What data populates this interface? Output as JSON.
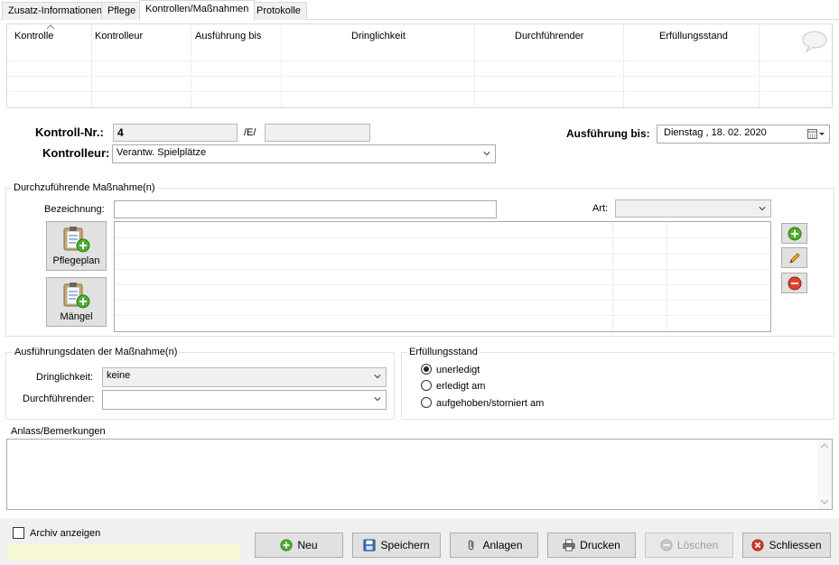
{
  "tabs": [
    {
      "label": "Zusatz-Informationen"
    },
    {
      "label": "Pflege"
    },
    {
      "label": "Kontrollen/Maßnahmen"
    },
    {
      "label": "Protokolle"
    }
  ],
  "grid": {
    "columns": [
      "Kontrolle",
      "Kontrolleur",
      "Ausführung bis",
      "Dringlichkeit",
      "Durchführender",
      "Erfüllungsstand"
    ]
  },
  "form": {
    "kontroll_nr_label": "Kontroll-Nr.:",
    "kontroll_nr_value": "4",
    "e_separator": "/E/",
    "e_value": "",
    "ausfuehrung_label": "Ausführung bis:",
    "ausfuehrung_day": "Dienstag",
    "ausfuehrung_date": ", 18. 02. 2020",
    "kontrolleur_label": "Kontrolleur:",
    "kontrolleur_value": "Verantw. Spielplätze"
  },
  "massnahme": {
    "group_title": "Durchzuführende Maßnahme(n)",
    "bezeichnung_label": "Bezeichnung:",
    "bezeichnung_value": "",
    "art_label": "Art:",
    "art_value": "",
    "pflegeplan_label": "Pflegeplan",
    "maengel_label": "Mängel"
  },
  "ausfuehrungsdaten": {
    "group_title": "Ausführungsdaten der Maßnahme(n)",
    "dringlichkeit_label": "Dringlichkeit:",
    "dringlichkeit_value": "keine",
    "durchfuehrender_label": "Durchführender:",
    "durchfuehrender_value": ""
  },
  "erfuellungsstand": {
    "group_title": "Erfüllungsstand",
    "options": [
      "unerledigt",
      "erledigt am",
      "aufgehoben/storniert am"
    ],
    "selected": "unerledigt"
  },
  "anlass": {
    "group_title": "Anlass/Bemerkungen",
    "value": ""
  },
  "footer": {
    "archiv_label": "Archiv anzeigen",
    "archiv_checked": false,
    "buttons": {
      "neu": "Neu",
      "speichern": "Speichern",
      "anlagen": "Anlagen",
      "drucken": "Drucken",
      "loeschen": "Löschen",
      "schliessen": "Schliessen"
    }
  },
  "colors": {
    "accent_green": "#3a9d23",
    "delete_red": "#d9352a",
    "status_yellow": "#f7f9d6"
  }
}
